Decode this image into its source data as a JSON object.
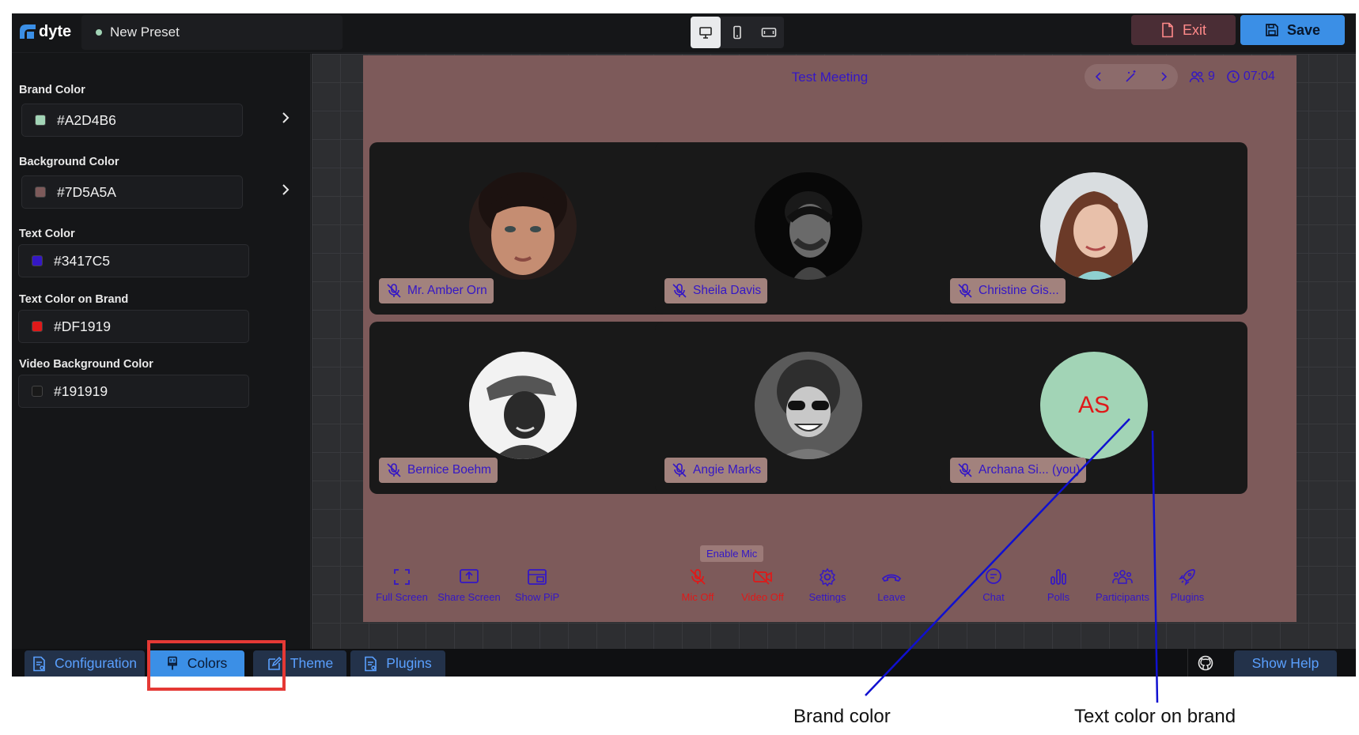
{
  "app": {
    "logo_text": "dyte",
    "preset_name": "New Preset"
  },
  "header": {
    "exit_label": "Exit",
    "save_label": "Save"
  },
  "colors": {
    "brand": "#A2D4B6",
    "background": "#7D5A5A",
    "text": "#3417C5",
    "text_on_brand": "#DF1919",
    "video_background": "#191919",
    "accent": "#3B8FE6"
  },
  "sidebar": {
    "fields": [
      {
        "label": "Brand Color",
        "value": "#A2D4B6"
      },
      {
        "label": "Background Color",
        "value": "#7D5A5A"
      },
      {
        "label": "Text Color",
        "value": "#3417C5"
      },
      {
        "label": "Text Color on Brand",
        "value": "#DF1919"
      },
      {
        "label": "Video Background Color",
        "value": "#191919"
      }
    ]
  },
  "meeting": {
    "title": "Test Meeting",
    "participant_count": "9",
    "time": "07:04",
    "participants": [
      {
        "name": "Mr. Amber Orn"
      },
      {
        "name": "Sheila Davis"
      },
      {
        "name": "Christine Gis..."
      },
      {
        "name": "Bernice Boehm"
      },
      {
        "name": "Angie Marks"
      },
      {
        "name": "Archana Si... (you)",
        "initials": "AS"
      }
    ],
    "tooltip": "Enable Mic",
    "controls": [
      {
        "label": "Full Screen",
        "icon": "fullscreen-icon"
      },
      {
        "label": "Share Screen",
        "icon": "share-screen-icon"
      },
      {
        "label": "Show PiP",
        "icon": "pip-icon"
      },
      {
        "label": "Mic Off",
        "icon": "mic-off-icon"
      },
      {
        "label": "Video Off",
        "icon": "video-off-icon"
      },
      {
        "label": "Settings",
        "icon": "settings-icon"
      },
      {
        "label": "Leave",
        "icon": "leave-icon"
      },
      {
        "label": "Chat",
        "icon": "chat-icon"
      },
      {
        "label": "Polls",
        "icon": "polls-icon"
      },
      {
        "label": "Participants",
        "icon": "participants-icon"
      },
      {
        "label": "Plugins",
        "icon": "plugins-icon"
      }
    ]
  },
  "tabs": [
    {
      "label": "Configuration"
    },
    {
      "label": "Colors",
      "active": true
    },
    {
      "label": "Theme"
    },
    {
      "label": "Plugins"
    }
  ],
  "footer": {
    "help_label": "Show Help"
  },
  "annotations": {
    "brand": "Brand color",
    "text_on_brand": "Text color on brand"
  }
}
